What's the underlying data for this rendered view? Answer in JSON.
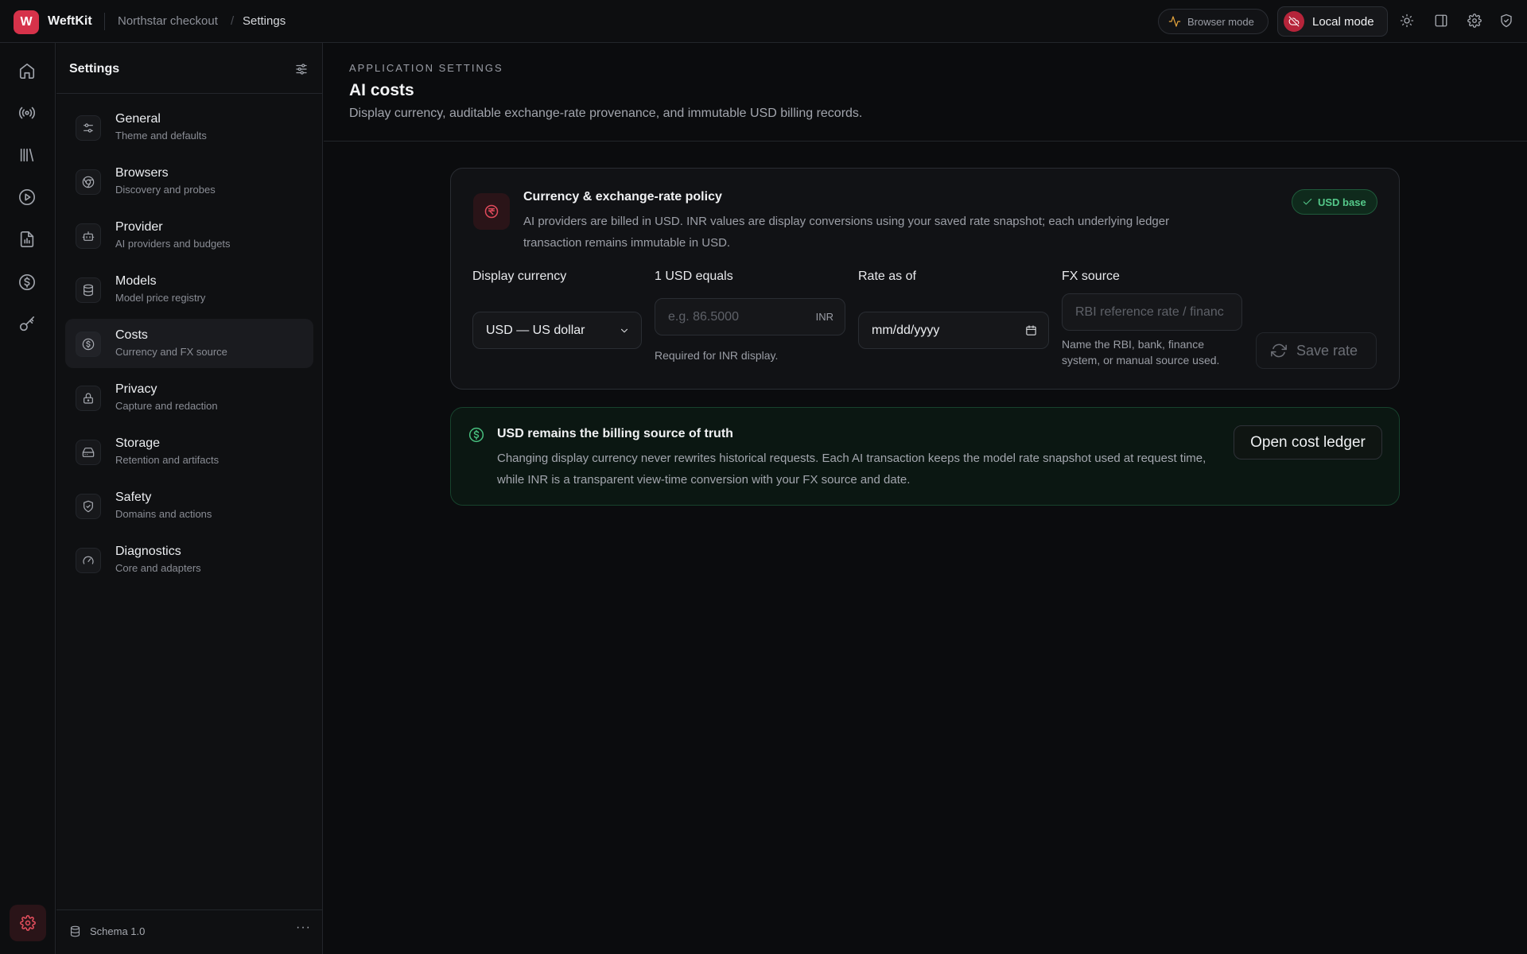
{
  "app": {
    "logo_letter": "W",
    "name": "WeftKit"
  },
  "breadcrumb": {
    "project": "Northstar checkout",
    "separator": "/",
    "current": "Settings"
  },
  "topbar": {
    "browser_mode_label": "Browser mode",
    "local_mode_label": "Local mode",
    "icons": [
      "activity-icon",
      "cloud-off-icon",
      "sun-icon",
      "panel-icon",
      "gear-icon",
      "shield-icon"
    ]
  },
  "rail": {
    "icons": [
      "home-icon",
      "radio-icon",
      "library-icon",
      "play-icon",
      "report-icon",
      "dollar-icon",
      "key-icon"
    ],
    "active": "gear-icon"
  },
  "sidebar": {
    "title": "Settings",
    "items": [
      {
        "label": "General",
        "sub": "Theme and defaults",
        "icon": "sliders-icon"
      },
      {
        "label": "Browsers",
        "sub": "Discovery and probes",
        "icon": "chrome-icon"
      },
      {
        "label": "Provider",
        "sub": "AI providers and budgets",
        "icon": "bot-icon"
      },
      {
        "label": "Models",
        "sub": "Model price registry",
        "icon": "database-icon"
      },
      {
        "label": "Costs",
        "sub": "Currency and FX source",
        "icon": "dollar-icon",
        "active": true
      },
      {
        "label": "Privacy",
        "sub": "Capture and redaction",
        "icon": "lock-icon"
      },
      {
        "label": "Storage",
        "sub": "Retention and artifacts",
        "icon": "hard-drive-icon"
      },
      {
        "label": "Safety",
        "sub": "Domains and actions",
        "icon": "shield-check-icon"
      },
      {
        "label": "Diagnostics",
        "sub": "Core and adapters",
        "icon": "gauge-icon"
      }
    ],
    "footer": {
      "schema": "Schema 1.0",
      "more": "···"
    }
  },
  "header": {
    "eyebrow": "APPLICATION SETTINGS",
    "title": "AI costs",
    "description": "Display currency, auditable exchange-rate provenance, and immutable USD billing records."
  },
  "policy": {
    "title": "Currency & exchange-rate policy",
    "description": "AI providers are billed in USD. INR values are display conversions using your saved rate snapshot; each underlying ledger transaction remains immutable in USD.",
    "badge": "USD base",
    "display_currency": {
      "label": "Display currency",
      "value": "USD — US dollar"
    },
    "usd_equals": {
      "label": "1 USD equals",
      "placeholder": "e.g. 86.5000",
      "suffix": "INR",
      "hint": "Required for INR display."
    },
    "rate_as_of": {
      "label": "Rate as of",
      "placeholder": "mm/dd/yyyy"
    },
    "fx_source": {
      "label": "FX source",
      "placeholder": "RBI reference rate / financ",
      "hint": "Name the RBI, bank, finance system, or manual source used."
    },
    "save_label": "Save rate"
  },
  "note": {
    "title": "USD remains the billing source of truth",
    "description": "Changing display currency never rewrites historical requests. Each AI transaction keeps the model rate snapshot used at request time, while INR is a transparent view-time conversion with your FX source and date.",
    "button": "Open cost ledger"
  },
  "colors": {
    "accent": "#d6324a",
    "success": "#48c07f",
    "background": "#0b0c0e"
  }
}
